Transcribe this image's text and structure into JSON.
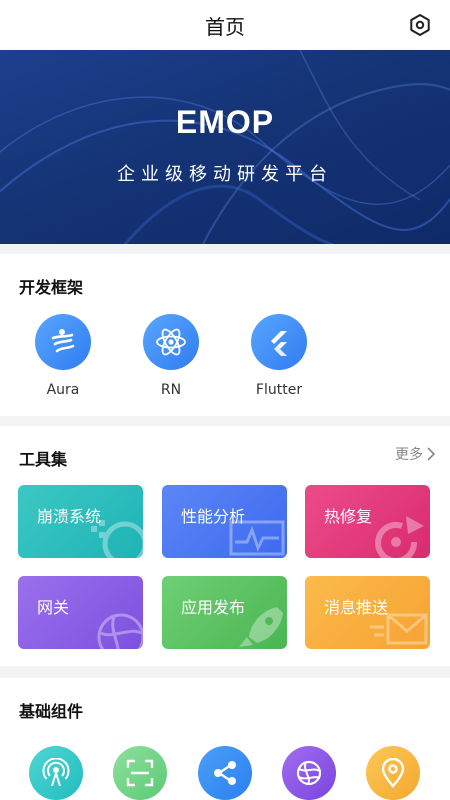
{
  "header": {
    "title": "首页",
    "settings_icon": "hexagon-settings-icon"
  },
  "banner": {
    "title": "EMOP",
    "subtitle": "企业级移动研发平台"
  },
  "frameworks": {
    "title": "开发框架",
    "items": [
      {
        "label": "Aura",
        "icon": "aura-icon"
      },
      {
        "label": "RN",
        "icon": "react-icon"
      },
      {
        "label": "Flutter",
        "icon": "flutter-icon"
      }
    ]
  },
  "tools": {
    "title": "工具集",
    "more_label": "更多",
    "items": [
      {
        "label": "崩溃系统",
        "color_from": "#3cc8c4",
        "color_to": "#1fb3b5"
      },
      {
        "label": "性能分析",
        "color_from": "#5c86f5",
        "color_to": "#3d6af0"
      },
      {
        "label": "热修复",
        "color_from": "#ec4c8a",
        "color_to": "#d92b6f"
      },
      {
        "label": "网关",
        "color_from": "#9a70ec",
        "color_to": "#7d51df"
      },
      {
        "label": "应用发布",
        "color_from": "#6fcf75",
        "color_to": "#4bb653"
      },
      {
        "label": "消息推送",
        "color_from": "#fbbb4a",
        "color_to": "#f6a233"
      }
    ]
  },
  "components": {
    "title": "基础组件",
    "items": [
      {
        "icon": "broadcast-icon",
        "color": "#2ec7c9"
      },
      {
        "icon": "scan-icon",
        "color": "#6fd48a"
      },
      {
        "icon": "share-icon",
        "color": "#3b8cf2"
      },
      {
        "icon": "globe-icon",
        "color": "#8a55e6"
      },
      {
        "icon": "location-pin-icon",
        "color": "#f7b63c"
      }
    ]
  }
}
